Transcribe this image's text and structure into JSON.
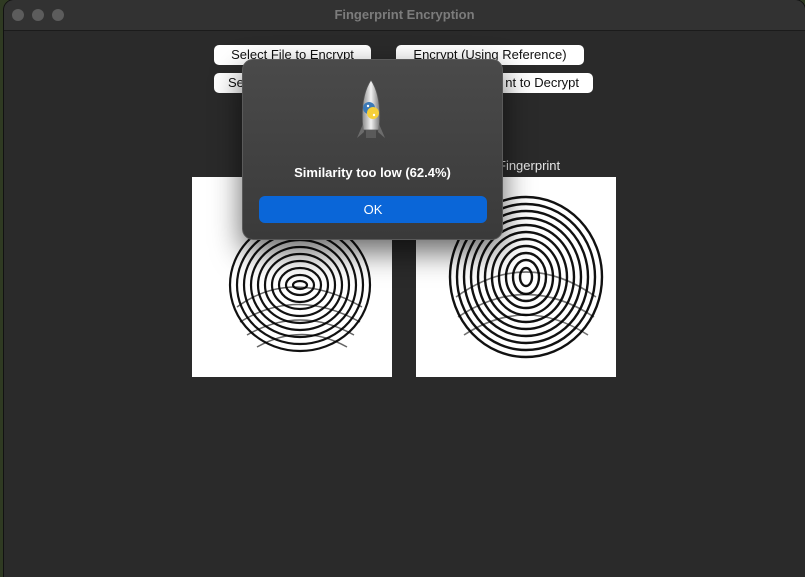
{
  "window": {
    "title": "Fingerprint Encryption"
  },
  "buttons": {
    "select_file_encrypt": "Select File to Encrypt",
    "encrypt_reference": "Encrypt (Using Reference)",
    "select_partial": "Se",
    "decrypt_partial": "nt to Decrypt"
  },
  "labels": {
    "right_image_partial": "Fingerprint"
  },
  "dialog": {
    "message": "Similarity too low (62.4%)",
    "ok_label": "OK",
    "icon": "python-rocket-icon"
  },
  "colors": {
    "accent": "#0a66d8",
    "window_bg": "#2a2a2a",
    "dialog_bg": "#424242"
  }
}
